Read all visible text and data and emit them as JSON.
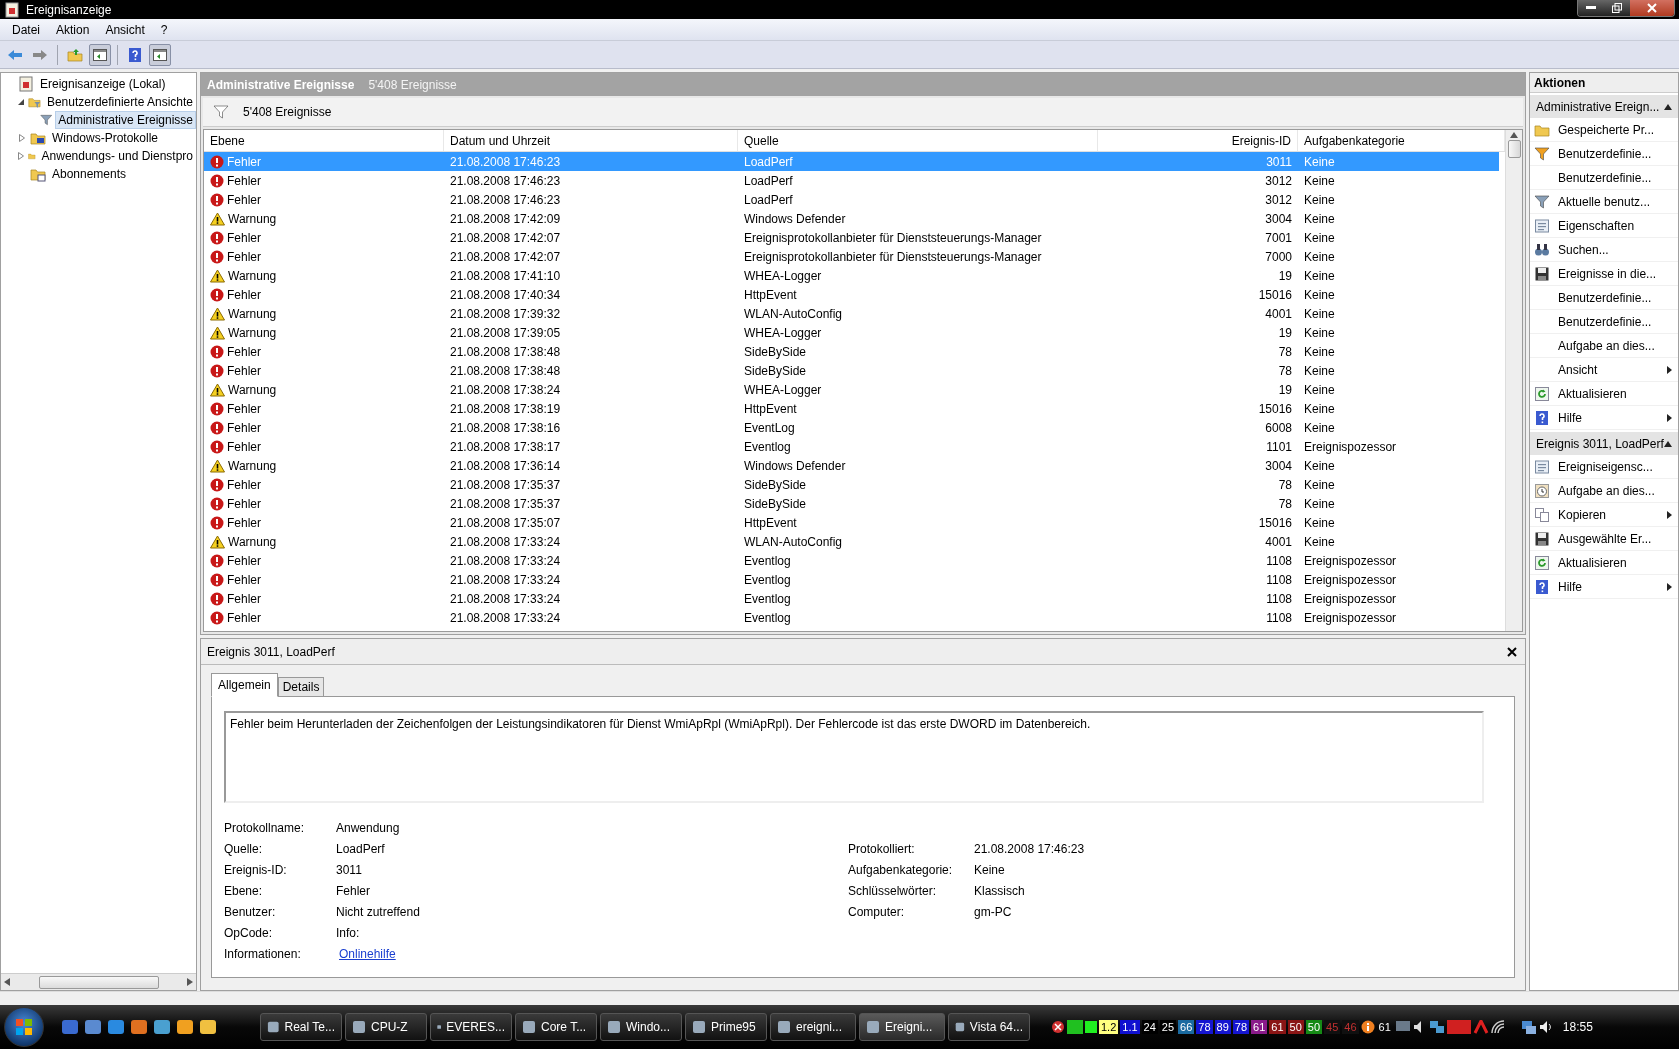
{
  "window": {
    "title": "Ereignisanzeige"
  },
  "menu": [
    "Datei",
    "Aktion",
    "Ansicht",
    "?"
  ],
  "toolbar": [
    {
      "kind": "back",
      "pressed": false
    },
    {
      "kind": "forward",
      "pressed": false
    },
    {
      "kind": "sep"
    },
    {
      "kind": "up",
      "pressed": false
    },
    {
      "kind": "pane",
      "pressed": true
    },
    {
      "kind": "sep"
    },
    {
      "kind": "help",
      "pressed": false
    },
    {
      "kind": "pane",
      "pressed": true
    }
  ],
  "tree": [
    {
      "label": "Ereignisanzeige (Lokal)",
      "selected": false,
      "children": [
        {
          "label": "Benutzerdefinierte Ansichte",
          "expanded": true,
          "selected": false,
          "children": [
            {
              "label": "Administrative Ereignisse",
              "selected": true
            }
          ]
        },
        {
          "label": "Windows-Protokolle",
          "expanded": false,
          "selected": false
        },
        {
          "label": "Anwendungs- und Dienstpro",
          "expanded": false,
          "selected": false
        },
        {
          "label": "Abonnements",
          "selected": false
        }
      ]
    }
  ],
  "header": {
    "title": "Administrative Ereignisse",
    "count": "5'408 Ereignisse"
  },
  "filter_bar": {
    "text": "5'408 Ereignisse"
  },
  "table": {
    "columns": [
      "Ebene",
      "Datum und Uhrzeit",
      "Quelle",
      "Ereignis-ID",
      "Aufgabenkategorie"
    ],
    "rows": [
      {
        "kind": "error",
        "level": "Fehler",
        "date": "21.08.2008 17:46:23",
        "source": "LoadPerf",
        "id": "3011",
        "category": "Keine",
        "selected": true
      },
      {
        "kind": "error",
        "level": "Fehler",
        "date": "21.08.2008 17:46:23",
        "source": "LoadPerf",
        "id": "3012",
        "category": "Keine",
        "selected": false
      },
      {
        "kind": "error",
        "level": "Fehler",
        "date": "21.08.2008 17:46:23",
        "source": "LoadPerf",
        "id": "3012",
        "category": "Keine",
        "selected": false
      },
      {
        "kind": "warning",
        "level": "Warnung",
        "date": "21.08.2008 17:42:09",
        "source": "Windows Defender",
        "id": "3004",
        "category": "Keine",
        "selected": false
      },
      {
        "kind": "error",
        "level": "Fehler",
        "date": "21.08.2008 17:42:07",
        "source": "Ereignisprotokollanbieter für Dienststeuerungs-Manager",
        "id": "7001",
        "category": "Keine",
        "selected": false
      },
      {
        "kind": "error",
        "level": "Fehler",
        "date": "21.08.2008 17:42:07",
        "source": "Ereignisprotokollanbieter für Dienststeuerungs-Manager",
        "id": "7000",
        "category": "Keine",
        "selected": false
      },
      {
        "kind": "warning",
        "level": "Warnung",
        "date": "21.08.2008 17:41:10",
        "source": "WHEA-Logger",
        "id": "19",
        "category": "Keine",
        "selected": false
      },
      {
        "kind": "error",
        "level": "Fehler",
        "date": "21.08.2008 17:40:34",
        "source": "HttpEvent",
        "id": "15016",
        "category": "Keine",
        "selected": false
      },
      {
        "kind": "warning",
        "level": "Warnung",
        "date": "21.08.2008 17:39:32",
        "source": "WLAN-AutoConfig",
        "id": "4001",
        "category": "Keine",
        "selected": false
      },
      {
        "kind": "warning",
        "level": "Warnung",
        "date": "21.08.2008 17:39:05",
        "source": "WHEA-Logger",
        "id": "19",
        "category": "Keine",
        "selected": false
      },
      {
        "kind": "error",
        "level": "Fehler",
        "date": "21.08.2008 17:38:48",
        "source": "SideBySide",
        "id": "78",
        "category": "Keine",
        "selected": false
      },
      {
        "kind": "error",
        "level": "Fehler",
        "date": "21.08.2008 17:38:48",
        "source": "SideBySide",
        "id": "78",
        "category": "Keine",
        "selected": false
      },
      {
        "kind": "warning",
        "level": "Warnung",
        "date": "21.08.2008 17:38:24",
        "source": "WHEA-Logger",
        "id": "19",
        "category": "Keine",
        "selected": false
      },
      {
        "kind": "error",
        "level": "Fehler",
        "date": "21.08.2008 17:38:19",
        "source": "HttpEvent",
        "id": "15016",
        "category": "Keine",
        "selected": false
      },
      {
        "kind": "error",
        "level": "Fehler",
        "date": "21.08.2008 17:38:16",
        "source": "EventLog",
        "id": "6008",
        "category": "Keine",
        "selected": false
      },
      {
        "kind": "error",
        "level": "Fehler",
        "date": "21.08.2008 17:38:17",
        "source": "Eventlog",
        "id": "1101",
        "category": "Ereignispozessor",
        "selected": false
      },
      {
        "kind": "warning",
        "level": "Warnung",
        "date": "21.08.2008 17:36:14",
        "source": "Windows Defender",
        "id": "3004",
        "category": "Keine",
        "selected": false
      },
      {
        "kind": "error",
        "level": "Fehler",
        "date": "21.08.2008 17:35:37",
        "source": "SideBySide",
        "id": "78",
        "category": "Keine",
        "selected": false
      },
      {
        "kind": "error",
        "level": "Fehler",
        "date": "21.08.2008 17:35:37",
        "source": "SideBySide",
        "id": "78",
        "category": "Keine",
        "selected": false
      },
      {
        "kind": "error",
        "level": "Fehler",
        "date": "21.08.2008 17:35:07",
        "source": "HttpEvent",
        "id": "15016",
        "category": "Keine",
        "selected": false
      },
      {
        "kind": "warning",
        "level": "Warnung",
        "date": "21.08.2008 17:33:24",
        "source": "WLAN-AutoConfig",
        "id": "4001",
        "category": "Keine",
        "selected": false
      },
      {
        "kind": "error",
        "level": "Fehler",
        "date": "21.08.2008 17:33:24",
        "source": "Eventlog",
        "id": "1108",
        "category": "Ereignispozessor",
        "selected": false
      },
      {
        "kind": "error",
        "level": "Fehler",
        "date": "21.08.2008 17:33:24",
        "source": "Eventlog",
        "id": "1108",
        "category": "Ereignispozessor",
        "selected": false
      },
      {
        "kind": "error",
        "level": "Fehler",
        "date": "21.08.2008 17:33:24",
        "source": "Eventlog",
        "id": "1108",
        "category": "Ereignispozessor",
        "selected": false
      },
      {
        "kind": "error",
        "level": "Fehler",
        "date": "21.08.2008 17:33:24",
        "source": "Eventlog",
        "id": "1108",
        "category": "Ereignispozessor",
        "selected": false
      }
    ]
  },
  "detail": {
    "title": "Ereignis 3011, LoadPerf",
    "tabs": [
      {
        "label": "Allgemein",
        "selected": true
      },
      {
        "label": "Details",
        "selected": false
      }
    ],
    "message": "Fehler beim Herunterladen der Zeichenfolgen der Leistungsindikatoren für Dienst WmiApRpl (WmiApRpl). Der Fehlercode ist das erste DWORD im Datenbereich.",
    "left_fields": [
      {
        "label": "Protokollname:",
        "value": "Anwendung"
      },
      {
        "label": "Quelle:",
        "value": "LoadPerf"
      },
      {
        "label": "Ereignis-ID:",
        "value": "3011"
      },
      {
        "label": "Ebene:",
        "value": "Fehler"
      },
      {
        "label": "Benutzer:",
        "value": "Nicht zutreffend"
      },
      {
        "label": "OpCode:",
        "value": "Info:"
      },
      {
        "label": "Informationen:",
        "value": "Onlinehilfe",
        "kind": "link"
      }
    ],
    "right_fields": [
      {
        "label": "Protokolliert:",
        "value": "21.08.2008 17:46:23"
      },
      {
        "label": "Aufgabenkategorie:",
        "value": "Keine"
      },
      {
        "label": "Schlüsselwörter:",
        "value": "Klassisch"
      },
      {
        "label": "Computer:",
        "value": "gm-PC"
      }
    ]
  },
  "actions": {
    "title": "Aktionen",
    "sections": [
      {
        "title": "Administrative Ereign...",
        "expanded": true,
        "items": [
          {
            "label": "Gespeicherte Pr...",
            "submenu": false
          },
          {
            "label": "Benutzerdefinie...",
            "submenu": false
          },
          {
            "label": "Benutzerdefinie...",
            "submenu": false
          },
          {
            "label": "Aktuelle benutz...",
            "submenu": false
          },
          {
            "label": "Eigenschaften",
            "submenu": false
          },
          {
            "label": "Suchen...",
            "submenu": false
          },
          {
            "label": "Ereignisse in die...",
            "submenu": false
          },
          {
            "label": "Benutzerdefinie...",
            "submenu": false
          },
          {
            "label": "Benutzerdefinie...",
            "submenu": false
          },
          {
            "label": "Aufgabe an dies...",
            "submenu": false
          },
          {
            "label": "Ansicht",
            "submenu": true
          },
          {
            "label": "Aktualisieren",
            "submenu": false
          },
          {
            "label": "Hilfe",
            "submenu": true
          }
        ]
      },
      {
        "title": "Ereignis 3011, LoadPerf",
        "expanded": true,
        "items": [
          {
            "label": "Ereigniseigensc...",
            "submenu": false
          },
          {
            "label": "Aufgabe an dies...",
            "submenu": false
          },
          {
            "label": "Kopieren",
            "submenu": true
          },
          {
            "label": "Ausgewählte Er...",
            "submenu": false
          },
          {
            "label": "Aktualisieren",
            "submenu": false
          },
          {
            "label": "Hilfe",
            "submenu": true
          }
        ]
      }
    ]
  },
  "taskbar": {
    "buttons": [
      {
        "label": "Real Te...",
        "selected": false
      },
      {
        "label": "CPU-Z",
        "selected": false
      },
      {
        "label": "EVERES...",
        "selected": false
      },
      {
        "label": "Core T...",
        "selected": false
      },
      {
        "label": "Windo...",
        "selected": false
      },
      {
        "label": "Prime95",
        "selected": false
      },
      {
        "label": "ereigni...",
        "selected": false
      },
      {
        "label": "Ereigni...",
        "selected": true
      },
      {
        "label": "Vista 64...",
        "selected": false
      }
    ],
    "tray": [
      {
        "text": "1.2",
        "color": "#ffff80"
      },
      {
        "text": "1.1",
        "color": "#1010d0"
      },
      {
        "text": "24",
        "color": "#000000"
      },
      {
        "text": "25",
        "color": "#000000"
      },
      {
        "text": "66",
        "color": "#1a6aa0"
      },
      {
        "text": "78",
        "color": "#1515d0"
      },
      {
        "text": "89",
        "color": "#1515d0"
      },
      {
        "text": "78",
        "color": "#1515d0"
      },
      {
        "text": "61",
        "color": "#8a1a8a"
      },
      {
        "text": "61",
        "color": "#8a1515"
      },
      {
        "text": "50",
        "color": "#8a1515"
      },
      {
        "text": "50",
        "color": "#158a15"
      },
      {
        "text": "45",
        "color": "#101010"
      },
      {
        "text": "46",
        "color": "#101010"
      }
    ],
    "info_value": "61",
    "clock": "18:55"
  }
}
